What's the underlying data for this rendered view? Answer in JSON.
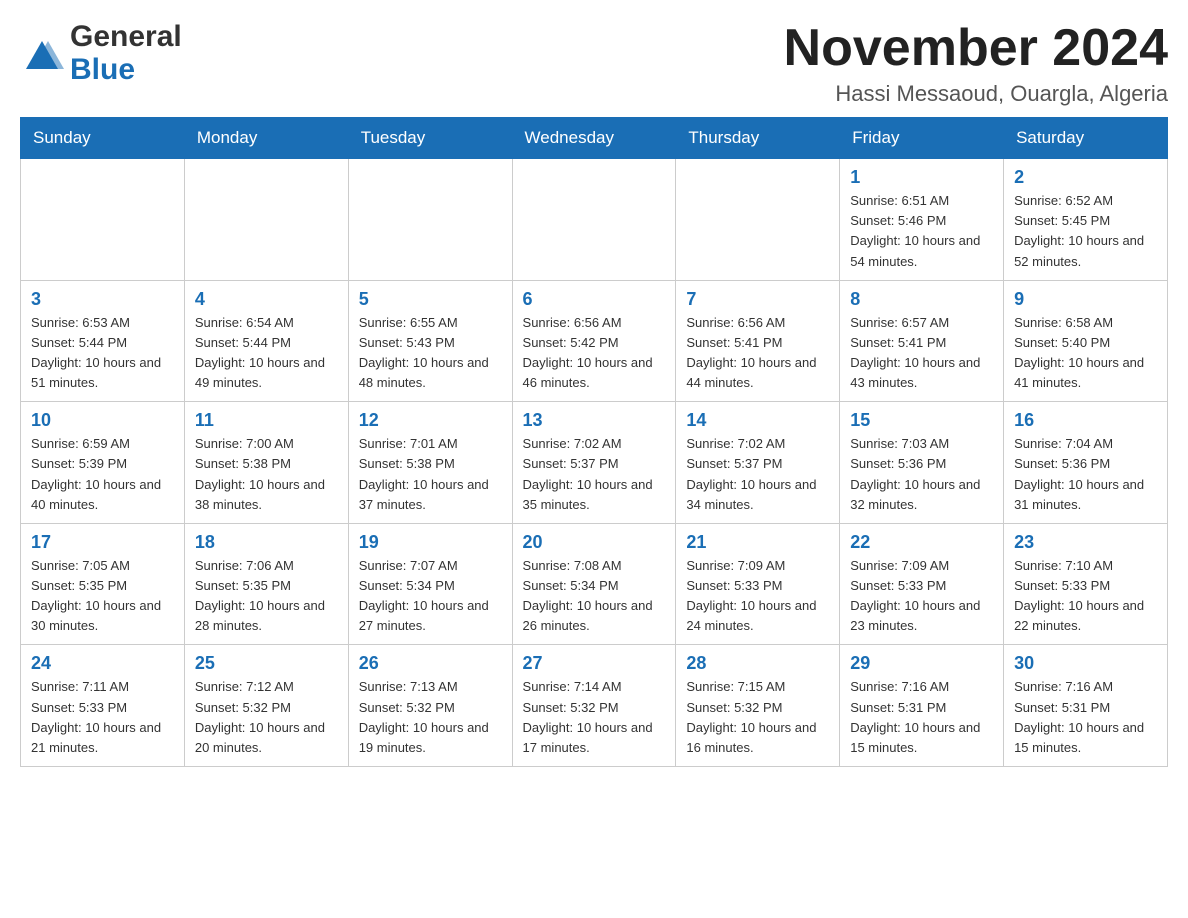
{
  "logo": {
    "general": "General",
    "blue": "Blue"
  },
  "title": "November 2024",
  "location": "Hassi Messaoud, Ouargla, Algeria",
  "days_of_week": [
    "Sunday",
    "Monday",
    "Tuesday",
    "Wednesday",
    "Thursday",
    "Friday",
    "Saturday"
  ],
  "weeks": [
    [
      {
        "day": "",
        "info": ""
      },
      {
        "day": "",
        "info": ""
      },
      {
        "day": "",
        "info": ""
      },
      {
        "day": "",
        "info": ""
      },
      {
        "day": "",
        "info": ""
      },
      {
        "day": "1",
        "info": "Sunrise: 6:51 AM\nSunset: 5:46 PM\nDaylight: 10 hours and 54 minutes."
      },
      {
        "day": "2",
        "info": "Sunrise: 6:52 AM\nSunset: 5:45 PM\nDaylight: 10 hours and 52 minutes."
      }
    ],
    [
      {
        "day": "3",
        "info": "Sunrise: 6:53 AM\nSunset: 5:44 PM\nDaylight: 10 hours and 51 minutes."
      },
      {
        "day": "4",
        "info": "Sunrise: 6:54 AM\nSunset: 5:44 PM\nDaylight: 10 hours and 49 minutes."
      },
      {
        "day": "5",
        "info": "Sunrise: 6:55 AM\nSunset: 5:43 PM\nDaylight: 10 hours and 48 minutes."
      },
      {
        "day": "6",
        "info": "Sunrise: 6:56 AM\nSunset: 5:42 PM\nDaylight: 10 hours and 46 minutes."
      },
      {
        "day": "7",
        "info": "Sunrise: 6:56 AM\nSunset: 5:41 PM\nDaylight: 10 hours and 44 minutes."
      },
      {
        "day": "8",
        "info": "Sunrise: 6:57 AM\nSunset: 5:41 PM\nDaylight: 10 hours and 43 minutes."
      },
      {
        "day": "9",
        "info": "Sunrise: 6:58 AM\nSunset: 5:40 PM\nDaylight: 10 hours and 41 minutes."
      }
    ],
    [
      {
        "day": "10",
        "info": "Sunrise: 6:59 AM\nSunset: 5:39 PM\nDaylight: 10 hours and 40 minutes."
      },
      {
        "day": "11",
        "info": "Sunrise: 7:00 AM\nSunset: 5:38 PM\nDaylight: 10 hours and 38 minutes."
      },
      {
        "day": "12",
        "info": "Sunrise: 7:01 AM\nSunset: 5:38 PM\nDaylight: 10 hours and 37 minutes."
      },
      {
        "day": "13",
        "info": "Sunrise: 7:02 AM\nSunset: 5:37 PM\nDaylight: 10 hours and 35 minutes."
      },
      {
        "day": "14",
        "info": "Sunrise: 7:02 AM\nSunset: 5:37 PM\nDaylight: 10 hours and 34 minutes."
      },
      {
        "day": "15",
        "info": "Sunrise: 7:03 AM\nSunset: 5:36 PM\nDaylight: 10 hours and 32 minutes."
      },
      {
        "day": "16",
        "info": "Sunrise: 7:04 AM\nSunset: 5:36 PM\nDaylight: 10 hours and 31 minutes."
      }
    ],
    [
      {
        "day": "17",
        "info": "Sunrise: 7:05 AM\nSunset: 5:35 PM\nDaylight: 10 hours and 30 minutes."
      },
      {
        "day": "18",
        "info": "Sunrise: 7:06 AM\nSunset: 5:35 PM\nDaylight: 10 hours and 28 minutes."
      },
      {
        "day": "19",
        "info": "Sunrise: 7:07 AM\nSunset: 5:34 PM\nDaylight: 10 hours and 27 minutes."
      },
      {
        "day": "20",
        "info": "Sunrise: 7:08 AM\nSunset: 5:34 PM\nDaylight: 10 hours and 26 minutes."
      },
      {
        "day": "21",
        "info": "Sunrise: 7:09 AM\nSunset: 5:33 PM\nDaylight: 10 hours and 24 minutes."
      },
      {
        "day": "22",
        "info": "Sunrise: 7:09 AM\nSunset: 5:33 PM\nDaylight: 10 hours and 23 minutes."
      },
      {
        "day": "23",
        "info": "Sunrise: 7:10 AM\nSunset: 5:33 PM\nDaylight: 10 hours and 22 minutes."
      }
    ],
    [
      {
        "day": "24",
        "info": "Sunrise: 7:11 AM\nSunset: 5:33 PM\nDaylight: 10 hours and 21 minutes."
      },
      {
        "day": "25",
        "info": "Sunrise: 7:12 AM\nSunset: 5:32 PM\nDaylight: 10 hours and 20 minutes."
      },
      {
        "day": "26",
        "info": "Sunrise: 7:13 AM\nSunset: 5:32 PM\nDaylight: 10 hours and 19 minutes."
      },
      {
        "day": "27",
        "info": "Sunrise: 7:14 AM\nSunset: 5:32 PM\nDaylight: 10 hours and 17 minutes."
      },
      {
        "day": "28",
        "info": "Sunrise: 7:15 AM\nSunset: 5:32 PM\nDaylight: 10 hours and 16 minutes."
      },
      {
        "day": "29",
        "info": "Sunrise: 7:16 AM\nSunset: 5:31 PM\nDaylight: 10 hours and 15 minutes."
      },
      {
        "day": "30",
        "info": "Sunrise: 7:16 AM\nSunset: 5:31 PM\nDaylight: 10 hours and 15 minutes."
      }
    ]
  ]
}
